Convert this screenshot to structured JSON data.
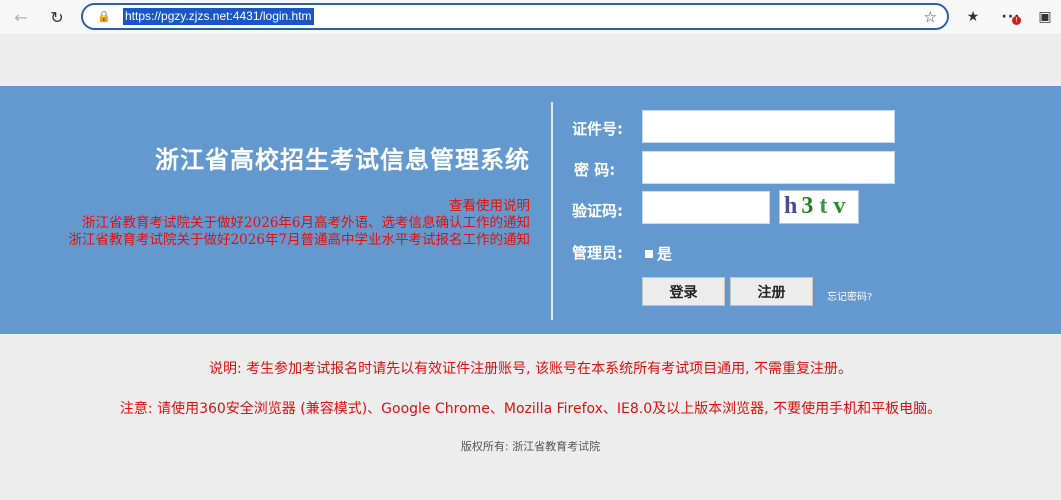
{
  "browser": {
    "url": "https://pgzy.zjzs.net:4431/login.htm",
    "back_icon": "arrow-left-icon",
    "reload_icon": "reload-icon",
    "star_icon": "star-icon",
    "favorites_icon": "favorites-icon",
    "more_icon": "more-icon",
    "badge": "!",
    "extension_icon": "extension-icon"
  },
  "header": {
    "title": "浙江省高校招生考试信息管理系统"
  },
  "notices": [
    "查看使用说明",
    "浙江省教育考试院关于做好2026年6月高考外语、选考信息确认工作的通知",
    "浙江省教育考试院关于做好2026年7月普通高中学业水平考试报名工作的通知"
  ],
  "login": {
    "id_label": "证件号:",
    "id_value": "",
    "password_label": "密 码:",
    "password_value": "",
    "captcha_label": "验证码:",
    "captcha_value": "",
    "captcha_chars": [
      "h",
      "3",
      "t",
      "v"
    ],
    "admin_label": "管理员:",
    "admin_option": "是",
    "login_button": "登录",
    "register_button": "注册",
    "forgot_link": "忘记密码?"
  },
  "footer": {
    "note1": "说明: 考生参加考试报名时请先以有效证件注册账号, 该账号在本系统所有考试项目通用, 不需重复注册。",
    "note2": "注意: 请使用360安全浏览器 (兼容模式)、Google Chrome、Mozilla Firefox、IE8.0及以上版本浏览器, 不要使用手机和平板电脑。",
    "copyright": "版权所有: 浙江省教育考试院"
  },
  "colors": {
    "banner": "#6399cf",
    "notice": "#e01010",
    "url_highlight": "#1a56c4"
  }
}
